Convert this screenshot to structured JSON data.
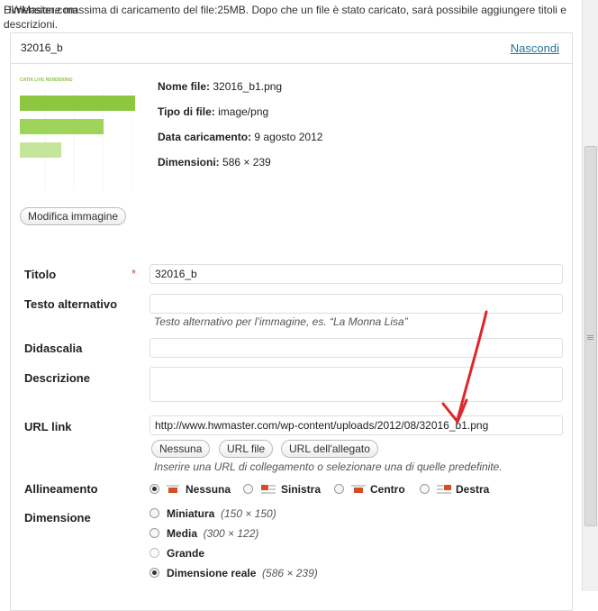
{
  "notice": {
    "text": "Dimensione massima di caricamento del file:25MB. Dopo che un file è stato caricato, sarà possibile aggiungere titoli e descrizioni.",
    "overlay": "HWMaster.com"
  },
  "attachment": {
    "header_name": "32016_b",
    "hide_link": "Nascondi",
    "thumbnail_title": "CATIA LIVE RENDERING",
    "meta": {
      "filename_label": "Nome file:",
      "filename_value": "32016_b1.png",
      "type_label": "Tipo di file:",
      "type_value": "image/png",
      "date_label": "Data caricamento:",
      "date_value": "9 agosto 2012",
      "dim_label": "Dimensioni:",
      "dim_value": "586 × 239"
    },
    "edit_image_button": "Modifica immagine"
  },
  "form": {
    "title_label": "Titolo",
    "required_mark": "*",
    "title_value": "32016_b",
    "alt_label": "Testo alternativo",
    "alt_value": "",
    "alt_help": "Testo alternativo per l’immagine, es. “La Monna Lisa”",
    "caption_label": "Didascalia",
    "caption_value": "",
    "desc_label": "Descrizione",
    "desc_value": "",
    "url_label": "URL link",
    "url_value": "http://www.hwmaster.com/wp-content/uploads/2012/08/32016_b1.png",
    "url_buttons": [
      "Nessuna",
      "URL file",
      "URL dell'allegato"
    ],
    "url_help": "Inserire una URL di collegamento o selezionare una di quelle predefinite.",
    "align_label": "Allineamento",
    "align_options": [
      "Nessuna",
      "Sinistra",
      "Centro",
      "Destra"
    ],
    "align_selected": "Nessuna",
    "size_label": "Dimensione",
    "size_options": [
      {
        "name": "Miniatura",
        "dims": "(150 × 150)"
      },
      {
        "name": "Media",
        "dims": "(300 × 122)"
      },
      {
        "name": "Grande",
        "dims": ""
      },
      {
        "name": "Dimensione reale",
        "dims": "(586 × 239)"
      }
    ],
    "size_selected": "Dimensione reale"
  },
  "colors": {
    "link": "#21759b",
    "required": "#d54e21",
    "annotation_arrow": "#e0262b",
    "thumb_bar": "#8dc63f"
  }
}
